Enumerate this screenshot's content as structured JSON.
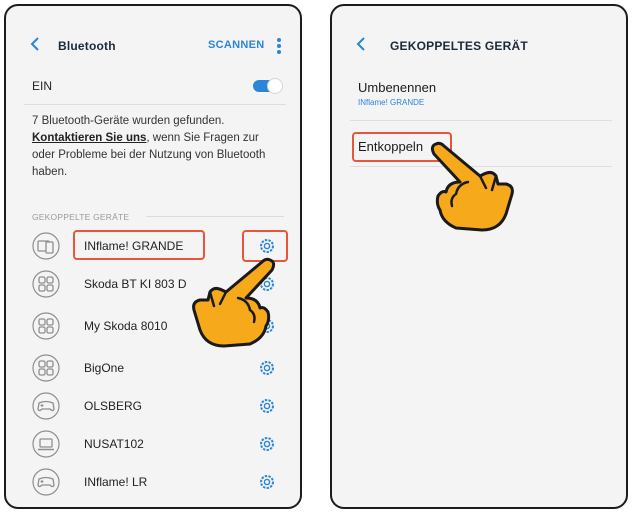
{
  "left_screen": {
    "back_icon": "chevron-left-icon",
    "title": "Bluetooth",
    "scan_label": "SCANNEN",
    "menu_icon": "kebab-menu-icon",
    "toggle_label": "EIN",
    "toggle_state": true,
    "info_text_start": "7 Bluetooth-Geräte wurden gefunden.",
    "info_link": "Kontaktieren Sie uns",
    "info_text_end": ", wenn Sie Fragen zur oder Probleme bei der Nutzung von Bluetooth haben.",
    "section_title": "GEKOPPELTE GERÄTE",
    "devices": [
      {
        "name": "INflame! GRANDE",
        "icon": "tablet-phone-icon"
      },
      {
        "name": "Skoda BT KI 803 D",
        "icon": "grid-device-icon"
      },
      {
        "name": "My Skoda 8010",
        "icon": "grid-device-icon"
      },
      {
        "name": "BigOne",
        "icon": "grid-device-icon"
      },
      {
        "name": "OLSBERG",
        "icon": "gamepad-icon"
      },
      {
        "name": "NUSAT102",
        "icon": "laptop-icon"
      },
      {
        "name": "INflame! LR",
        "icon": "gamepad-icon"
      }
    ],
    "settings_icon": "gear-icon"
  },
  "right_screen": {
    "back_icon": "chevron-left-icon",
    "title": "GEKOPPELTES GERÄT",
    "rename_label": "Umbenennen",
    "rename_sub": "INflame! GRANDE",
    "unpair_label": "Entkoppeln"
  },
  "colors": {
    "accent": "#2a86d6",
    "highlight": "#e8553a",
    "hand_fill": "#f6a91a",
    "hand_outline": "#1a1a1a"
  }
}
